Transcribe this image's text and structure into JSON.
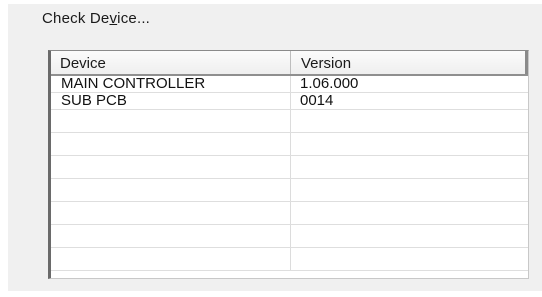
{
  "group": {
    "title_before": "Check De",
    "title_mnemonic": "v",
    "title_after": "ice..."
  },
  "list": {
    "columns": [
      "Device",
      "Version"
    ],
    "rows": [
      {
        "device": "MAIN CONTROLLER",
        "version": "1.06.000"
      },
      {
        "device": "SUB PCB",
        "version": "0014"
      }
    ]
  }
}
